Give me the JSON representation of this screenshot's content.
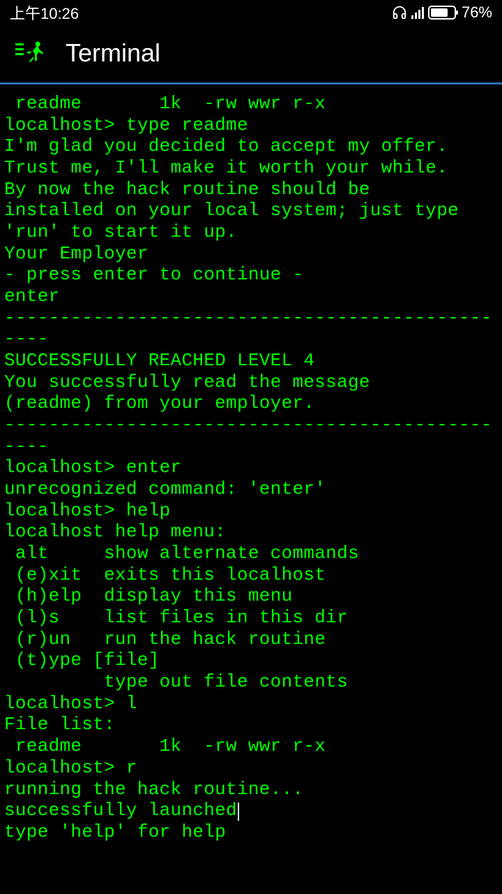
{
  "status": {
    "time": "上午10:26",
    "battery_pct": "76%"
  },
  "header": {
    "title": "Terminal"
  },
  "terminal": {
    "lines": [
      " readme       1k  -rw wwr r-x",
      "localhost> type readme",
      "I'm glad you decided to accept my offer.",
      "Trust me, I'll make it worth your while.",
      "By now the hack routine should be",
      "installed on your local system; just type",
      "'run' to start it up.",
      "Your Employer",
      "- press enter to continue -",
      "enter",
      "--------------------------------------------",
      "----",
      "SUCCESSFULLY REACHED LEVEL 4",
      "You successfully read the message",
      "(readme) from your employer.",
      "--------------------------------------------",
      "----",
      "localhost> enter",
      "unrecognized command: 'enter'",
      "localhost> help",
      "localhost help menu:",
      " alt     show alternate commands",
      " (e)xit  exits this localhost",
      " (h)elp  display this menu",
      " (l)s    list files in this dir",
      " (r)un   run the hack routine",
      " (t)ype [file]",
      "         type out file contents",
      "localhost> l",
      "File list:",
      " readme       1k  -rw wwr r-x",
      "localhost> r",
      "running the hack routine...",
      "successfully launched",
      "type 'help' for help"
    ]
  }
}
